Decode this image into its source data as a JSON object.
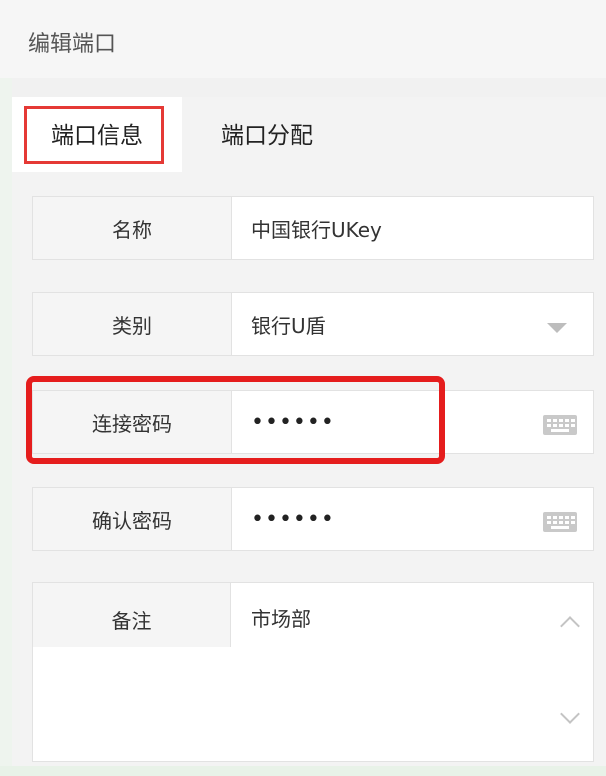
{
  "window": {
    "title": "编辑端口"
  },
  "tabs": [
    {
      "label": "端口信息",
      "active": true
    },
    {
      "label": "端口分配",
      "active": false
    }
  ],
  "form": {
    "name": {
      "label": "名称",
      "value": "中国银行UKey"
    },
    "type": {
      "label": "类别",
      "value": "银行U盾"
    },
    "password": {
      "label": "连接密码",
      "value": "••••••"
    },
    "confirm_password": {
      "label": "确认密码",
      "value": "••••••"
    },
    "remark": {
      "label": "备注",
      "value": "市场部"
    }
  },
  "icons": {
    "dropdown": "chevron-down-icon",
    "keyboard": "keyboard-icon",
    "scroll_up": "chevron-up-icon",
    "scroll_down": "chevron-down-icon"
  },
  "colors": {
    "highlight": "#e51d1d",
    "label_bg": "#f5f5f5",
    "border": "#e2e2e2"
  }
}
